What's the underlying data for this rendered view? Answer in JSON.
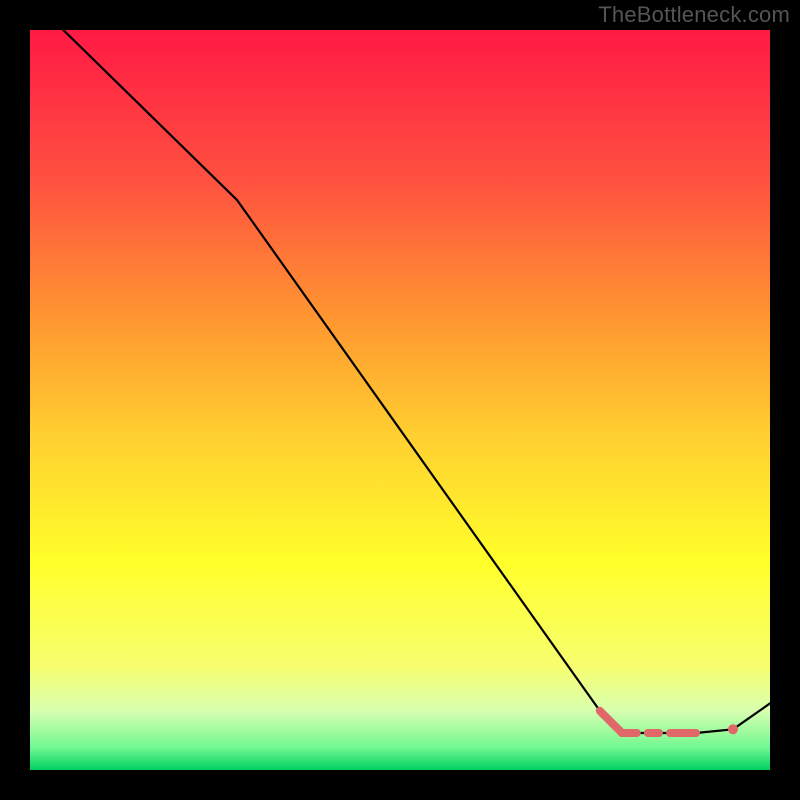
{
  "watermark": "TheBottleneck.com",
  "chart_data": {
    "type": "line",
    "title": "",
    "xlabel": "",
    "ylabel": "",
    "xlim": [
      0,
      100
    ],
    "ylim": [
      0,
      100
    ],
    "series": [
      {
        "name": "curve",
        "color": "#000000",
        "x": [
          4.5,
          28.0,
          77.0,
          80.0,
          90.0,
          95.0,
          100.0
        ],
        "y": [
          100.0,
          77.0,
          8.0,
          5.0,
          5.0,
          5.5,
          9.0
        ]
      }
    ],
    "highlight": {
      "color": "#e06868",
      "segments": [
        {
          "x1": 77.0,
          "y1": 8.0,
          "x2": 80.0,
          "y2": 5.0
        },
        {
          "x1": 80.0,
          "y1": 5.0,
          "x2": 82.0,
          "y2": 5.0
        },
        {
          "x1": 83.5,
          "y1": 5.0,
          "x2": 85.0,
          "y2": 5.0
        },
        {
          "x1": 86.5,
          "y1": 5.0,
          "x2": 90.0,
          "y2": 5.0
        }
      ],
      "points": [
        {
          "x": 95.0,
          "y": 5.5
        }
      ]
    },
    "background_gradient": {
      "stops": [
        {
          "offset": 0.0,
          "color": "#ff1a44"
        },
        {
          "offset": 0.2,
          "color": "#ff5040"
        },
        {
          "offset": 0.4,
          "color": "#ff9a30"
        },
        {
          "offset": 0.55,
          "color": "#ffd030"
        },
        {
          "offset": 0.72,
          "color": "#ffff2a"
        },
        {
          "offset": 0.86,
          "color": "#f7ff70"
        },
        {
          "offset": 0.92,
          "color": "#d8ffb0"
        },
        {
          "offset": 0.97,
          "color": "#70f890"
        },
        {
          "offset": 1.0,
          "color": "#00d060"
        }
      ]
    }
  }
}
